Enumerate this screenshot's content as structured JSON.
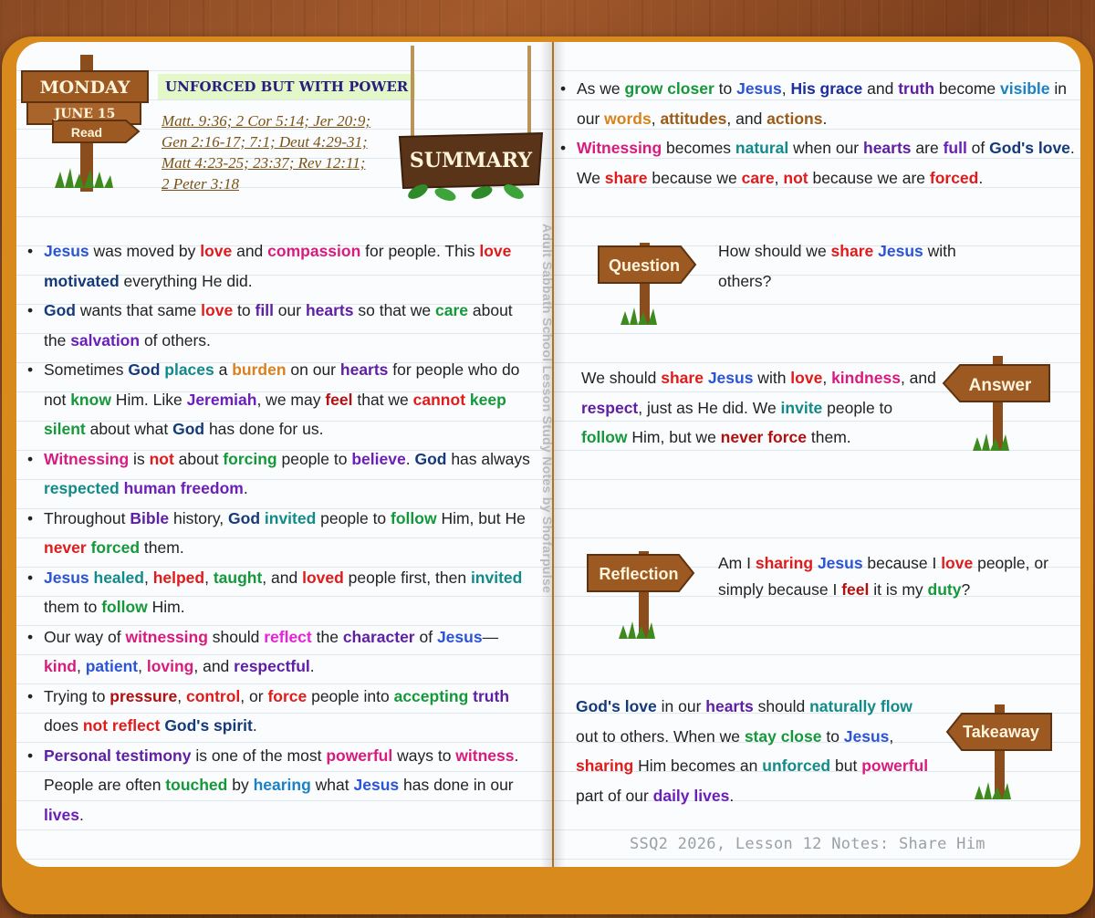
{
  "header": {
    "day": "MONDAY",
    "date": "JUNE 15",
    "read_label": "Read",
    "topic": "UNFORCED BUT WITH POWER",
    "references": [
      "Matt. 9:36; 2 Cor 5:14; Jer 20:9;",
      "Gen 2:16-17; 7:1; Deut 4:29-31;",
      "Matt 4:23-25; 23:37; Rev 12:11;",
      "2 Peter 3:18"
    ],
    "summary_label": "SUMMARY"
  },
  "spine_text": "Adult Sabbath School Lesson Study Notes by Shofarpulse",
  "left_bullets": [
    [
      [
        "Jesus",
        "c-blue"
      ],
      " was moved by ",
      [
        "love",
        "c-red"
      ],
      " and ",
      [
        "compassion",
        "c-mag"
      ],
      " for people. This ",
      [
        "love",
        "c-red"
      ],
      " ",
      [
        "motivated",
        "c-navy"
      ],
      " everything He did."
    ],
    [
      [
        "God",
        "c-navy"
      ],
      " wants that same ",
      [
        "love",
        "c-red"
      ],
      " to ",
      [
        "fill",
        "c-purple"
      ],
      " our ",
      [
        "hearts",
        "c-purple"
      ],
      " so that we ",
      [
        "care",
        "c-green"
      ],
      " about the ",
      [
        "salvation",
        "c-violet"
      ],
      " of others."
    ],
    [
      "Sometimes ",
      [
        "God",
        "c-navy"
      ],
      " ",
      [
        "places",
        "c-teal"
      ],
      " a ",
      [
        "burden",
        "c-orange"
      ],
      " on our ",
      [
        "hearts",
        "c-purple"
      ],
      " for people who do not ",
      [
        "know",
        "c-green"
      ],
      " Him. Like ",
      [
        "Jeremiah",
        "c-violet"
      ],
      ", we may ",
      [
        "feel",
        "c-dred"
      ],
      " that we ",
      [
        "cannot",
        "c-red"
      ],
      " ",
      [
        "keep silent",
        "c-green"
      ],
      " about what ",
      [
        "God",
        "c-navy"
      ],
      " has done for us."
    ],
    [
      [
        "Witnessing",
        "c-mag"
      ],
      " is ",
      [
        "not",
        "c-red"
      ],
      " about ",
      [
        "forcing",
        "c-green"
      ],
      " people to ",
      [
        "believe",
        "c-violet"
      ],
      ". ",
      [
        "God",
        "c-navy"
      ],
      " has always ",
      [
        "respected",
        "c-teal"
      ],
      " ",
      [
        "human freedom",
        "c-violet"
      ],
      "."
    ],
    [
      "Throughout ",
      [
        "Bible",
        "c-purple"
      ],
      " history, ",
      [
        "God",
        "c-navy"
      ],
      " ",
      [
        "invited",
        "c-teal"
      ],
      " people to ",
      [
        "follow",
        "c-green"
      ],
      " Him, but He ",
      [
        "never",
        "c-red"
      ],
      " ",
      [
        "forced",
        "c-green"
      ],
      " them."
    ],
    [
      [
        "Jesus",
        "c-blue"
      ],
      " ",
      [
        "healed",
        "c-teal"
      ],
      ", ",
      [
        "helped",
        "c-red"
      ],
      ", ",
      [
        "taught",
        "c-green"
      ],
      ", and ",
      [
        "loved",
        "c-red"
      ],
      " people first, then ",
      [
        "invited",
        "c-teal"
      ],
      " them to ",
      [
        "follow",
        "c-green"
      ],
      " Him."
    ],
    [
      "Our way of ",
      [
        "witnessing",
        "c-mag"
      ],
      " should ",
      [
        "reflect",
        "c-pink"
      ],
      " the ",
      [
        "character",
        "c-purple"
      ],
      " of ",
      [
        "Jesus",
        "c-blue"
      ],
      "— ",
      [
        "kind",
        "c-mag"
      ],
      ", ",
      [
        "patient",
        "c-blue"
      ],
      ", ",
      [
        "loving",
        "c-mag"
      ],
      ", and ",
      [
        "respectful",
        "c-purple"
      ],
      "."
    ],
    [
      "Trying to ",
      [
        "pressure",
        "c-dred"
      ],
      ", ",
      [
        "control",
        "c-red"
      ],
      ", or ",
      [
        "force",
        "c-red"
      ],
      " people into ",
      [
        "accepting",
        "c-green"
      ],
      " ",
      [
        "truth",
        "c-purple"
      ],
      " does ",
      [
        "not",
        "c-red"
      ],
      " ",
      [
        "reflect",
        "c-red"
      ],
      " ",
      [
        "God's spirit",
        "c-navy"
      ],
      "."
    ],
    [
      [
        "Personal testimony",
        "c-purple"
      ],
      " is one of the most ",
      [
        "powerful",
        "c-mag"
      ],
      " ways to ",
      [
        "witness",
        "c-mag"
      ],
      ". People are often ",
      [
        "touched",
        "c-green"
      ],
      " by ",
      [
        "hearing",
        "c-sky"
      ],
      " what ",
      [
        "Jesus",
        "c-blue"
      ],
      " has done in our ",
      [
        "lives",
        "c-violet"
      ],
      "."
    ]
  ],
  "right_bullets": [
    [
      "As we ",
      [
        "grow closer",
        "c-green"
      ],
      " to ",
      [
        "Jesus",
        "c-blue"
      ],
      ", ",
      [
        "His grace",
        "c-indigo"
      ],
      " and ",
      [
        "truth",
        "c-purple"
      ],
      " become ",
      [
        "visible",
        "c-sky"
      ],
      " in our ",
      [
        "words",
        "c-orange"
      ],
      ", ",
      [
        "attitudes",
        "c-brown"
      ],
      ", and ",
      [
        "actions",
        "c-brown"
      ],
      "."
    ],
    [
      [
        "Witnessing",
        "c-mag"
      ],
      " becomes ",
      [
        "natural",
        "c-teal"
      ],
      " when our ",
      [
        "hearts",
        "c-purple"
      ],
      " are ",
      [
        "full",
        "c-violet"
      ],
      " of ",
      [
        "God's love",
        "c-navy"
      ],
      ". We ",
      [
        "share",
        "c-red"
      ],
      " because we ",
      [
        "care",
        "c-red"
      ],
      ", ",
      [
        "not",
        "c-red"
      ],
      " because we are ",
      [
        "forced",
        "c-red"
      ],
      "."
    ]
  ],
  "qa": {
    "question_label": "Question",
    "question": [
      "How should we ",
      [
        "share",
        "c-red"
      ],
      " ",
      [
        "Jesus",
        "c-blue"
      ],
      " with others?"
    ],
    "answer_label": "Answer",
    "answer": [
      "We should ",
      [
        "share",
        "c-red"
      ],
      " ",
      [
        "Jesus",
        "c-blue"
      ],
      " with ",
      [
        "love",
        "c-red"
      ],
      ", ",
      [
        "kindness",
        "c-mag"
      ],
      ", and ",
      [
        "respect",
        "c-purple"
      ],
      ", just as He did. We ",
      [
        "invite",
        "c-teal"
      ],
      " people to ",
      [
        "follow",
        "c-green"
      ],
      " Him, but we ",
      [
        "never force",
        "c-dred"
      ],
      " them."
    ],
    "reflection_label": "Reflection",
    "reflection": [
      "Am I ",
      [
        "sharing",
        "c-red"
      ],
      " ",
      [
        "Jesus",
        "c-blue"
      ],
      " because I ",
      [
        "love",
        "c-red"
      ],
      " people, or simply because I ",
      [
        "feel",
        "c-dred"
      ],
      " it is my ",
      [
        "duty",
        "c-green"
      ],
      "?"
    ],
    "takeaway_label": "Takeaway",
    "takeaway": [
      [
        "God's love",
        "c-navy"
      ],
      " in our ",
      [
        "hearts",
        "c-purple"
      ],
      " should ",
      [
        "naturally flow",
        "c-teal"
      ],
      " out to others. When we ",
      [
        "stay close",
        "c-green"
      ],
      " to ",
      [
        "Jesus",
        "c-blue"
      ],
      ", ",
      [
        "sharing",
        "c-red"
      ],
      " Him becomes an ",
      [
        "unforced",
        "c-teal"
      ],
      " but ",
      [
        "powerful",
        "c-mag"
      ],
      " part of our ",
      [
        "daily lives",
        "c-violet"
      ],
      "."
    ]
  },
  "footer": "SSQ2 2026, Lesson 12 Notes: Share Him",
  "colors": {
    "cover": "#d98a1c",
    "sign_wood": "#9c5a22",
    "topic_bg": "#e4f7c8",
    "grass": "#3f8a1e"
  }
}
